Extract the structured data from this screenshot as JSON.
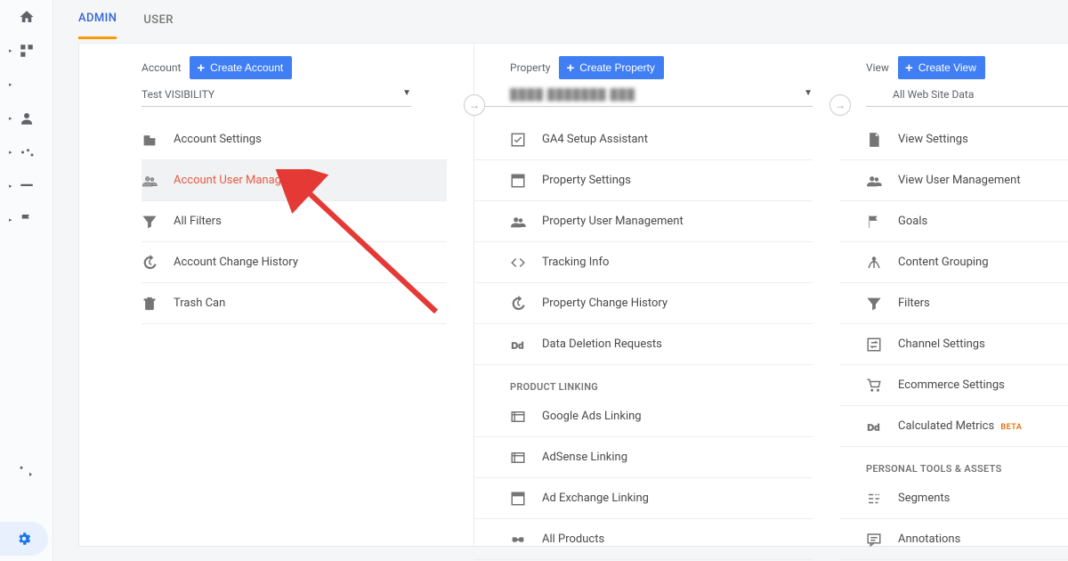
{
  "tabs": {
    "admin": "ADMIN",
    "user": "USER"
  },
  "account": {
    "label": "Account",
    "create": "Create Account",
    "selected": "Test VISIBILITY",
    "items": [
      {
        "label": "Account Settings"
      },
      {
        "label": "Account User Management",
        "selected": true
      },
      {
        "label": "All Filters"
      },
      {
        "label": "Account Change History"
      },
      {
        "label": "Trash Can"
      }
    ]
  },
  "property": {
    "label": "Property",
    "create": "Create Property",
    "selected_blurred": "████ ███████ ███",
    "items": [
      "GA4 Setup Assistant",
      "Property Settings",
      "Property User Management",
      "Tracking Info",
      "Property Change History",
      "Data Deletion Requests"
    ],
    "section": "PRODUCT LINKING",
    "items2": [
      "Google Ads Linking",
      "AdSense Linking",
      "Ad Exchange Linking",
      "All Products"
    ]
  },
  "view": {
    "label": "View",
    "create": "Create View",
    "selected": "All Web Site Data",
    "items": [
      "View Settings",
      "View User Management",
      "Goals",
      "Content Grouping",
      "Filters",
      "Channel Settings",
      "Ecommerce Settings"
    ],
    "calc_label": "Calculated Metrics",
    "calc_badge": "BETA",
    "section": "PERSONAL TOOLS & ASSETS",
    "items2": [
      "Segments",
      "Annotations"
    ]
  }
}
